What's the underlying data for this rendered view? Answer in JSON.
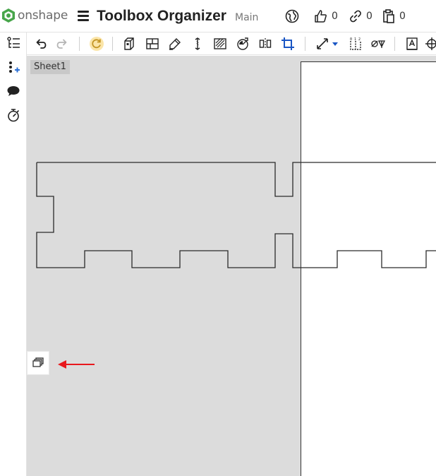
{
  "header": {
    "brand": "onshape",
    "document_title": "Toolbox Organizer",
    "branch": "Main",
    "likes": "0",
    "links": "0",
    "copies": "0",
    "icons": [
      "onshape-logo-icon",
      "menu-icon",
      "globe-icon",
      "thumbs-up-icon",
      "link-icon",
      "clipboard-icon"
    ]
  },
  "toolbar": {
    "icons": [
      "undo-icon",
      "redo-icon",
      "regenerate-icon",
      "insert-view-icon",
      "section-view-icon",
      "detail-view-icon",
      "break-view-icon",
      "hatch-icon",
      "auxiliary-view-icon",
      "mirror-view-icon",
      "crop-view-icon",
      "dimension-icon",
      "dimension-dropdown-icon",
      "ordinate-dimension-icon",
      "hole-table-icon",
      "note-icon",
      "centermark-icon"
    ]
  },
  "leftrail": {
    "icons": [
      "feature-list-icon",
      "add-part-icon",
      "comments-icon",
      "stopwatch-icon"
    ]
  },
  "canvas": {
    "sheet_name": "Sheet1",
    "float_button_icon": "stacked-views-icon",
    "annotation_arrow_color": "#e8181d"
  },
  "colors": {
    "brand_green": "#47a54a",
    "canvas_bg": "#dcdcdc",
    "paper_bg": "#ffffff",
    "line": "#333333"
  }
}
